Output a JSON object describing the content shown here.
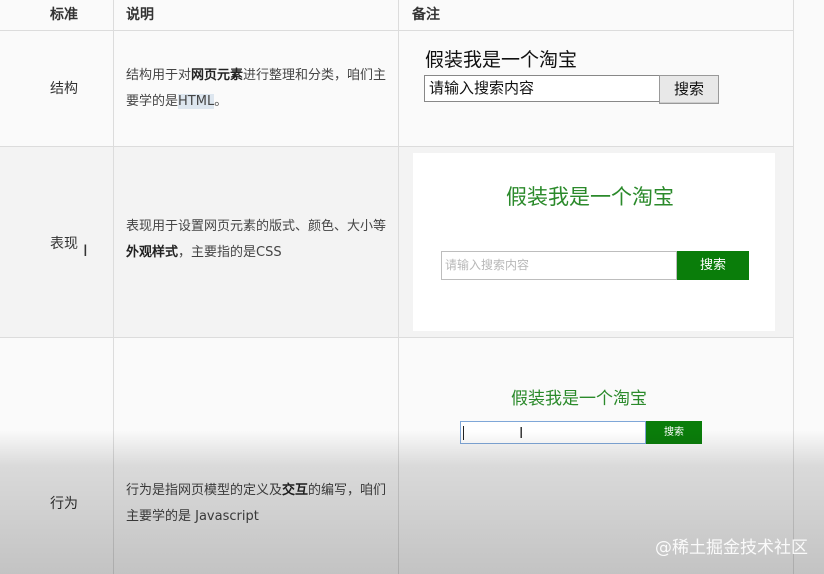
{
  "headers": [
    "标准",
    "说明",
    "备注"
  ],
  "rows": [
    {
      "name": "结构",
      "desc_parts": [
        "结构用于对",
        "网页元素",
        "进行整理和分类，咱们主要学的是",
        "HTML",
        "。"
      ],
      "demo": {
        "title": "假装我是一个淘宝",
        "input_value": "请输入搜索内容",
        "button": "搜索"
      }
    },
    {
      "name": "表现",
      "desc_parts": [
        "表现用于设置网页元素的版式、颜色、大小等",
        "外观样式",
        "，主要指的是CSS"
      ],
      "demo": {
        "title": "假装我是一个淘宝",
        "placeholder": "请输入搜索内容",
        "button": "搜索"
      }
    },
    {
      "name": "行为",
      "desc_parts": [
        "行为是指网页模型的定义及",
        "交互",
        "的编写，咱们主要学的是 Javascript"
      ],
      "demo": {
        "title": "假装我是一个淘宝",
        "input_value": "",
        "button": "搜索"
      }
    }
  ],
  "watermark": "@稀土掘金技术社区",
  "colors": {
    "green_text": "#2b8a2b",
    "green_button": "#0a7d0a",
    "border": "#dcdcdc"
  }
}
